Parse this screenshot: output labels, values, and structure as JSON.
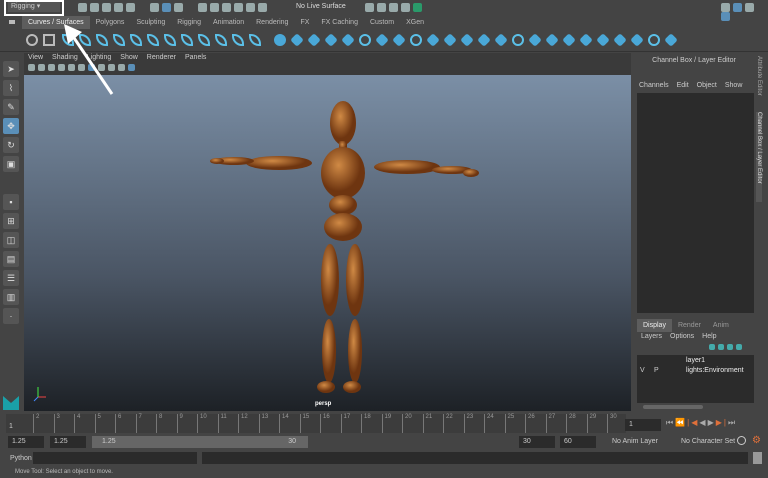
{
  "menu_set": "Rigging",
  "live_surface": "No Live Surface",
  "shelf_tabs": [
    "Curves / Surfaces",
    "Polygons",
    "Sculpting",
    "Rigging",
    "Animation",
    "Rendering",
    "FX",
    "FX Caching",
    "Custom",
    "XGen"
  ],
  "active_shelf": "Curves / Surfaces",
  "viewport": {
    "menu": [
      "View",
      "Shading",
      "Lighting",
      "Show",
      "Renderer",
      "Panels"
    ],
    "camera_label": "persp"
  },
  "channel_box": {
    "title": "Channel Box / Layer Editor",
    "menu": [
      "Channels",
      "Edit",
      "Object",
      "Show"
    ]
  },
  "layer_editor": {
    "tabs": [
      "Display",
      "Render",
      "Anim"
    ],
    "active_tab": "Display",
    "menu": [
      "Layers",
      "Options",
      "Help"
    ],
    "layers": [
      {
        "v": "",
        "p": "",
        "name": "layer1"
      },
      {
        "v": "V",
        "p": "P",
        "name": "lights:Environment"
      }
    ]
  },
  "side_tabs": [
    "Attribute Editor",
    "Channel Box / Layer Editor"
  ],
  "timeline": {
    "ticks": [
      "2",
      "3",
      "4",
      "5",
      "6",
      "7",
      "8",
      "9",
      "10",
      "11",
      "12",
      "13",
      "14",
      "15",
      "16",
      "17",
      "18",
      "19",
      "20",
      "21",
      "22",
      "23",
      "24",
      "25",
      "26",
      "27",
      "28",
      "29",
      "30"
    ],
    "start_label": "1",
    "current_frame": "1"
  },
  "range": {
    "start": "1.25",
    "play_start": "1.25",
    "slider_start": "1.25",
    "slider_end": "30",
    "end": "30",
    "max": "60",
    "anim_layer": "No Anim Layer",
    "character_set": "No Character Set"
  },
  "command": {
    "language": "Python"
  },
  "help_line": "Move Tool: Select an object to move.",
  "colors": {
    "accent": "#5bc0e8",
    "viewport_top": "#7b8fa6",
    "viewport_bottom": "#1d2126",
    "wood": "#a0561a"
  }
}
